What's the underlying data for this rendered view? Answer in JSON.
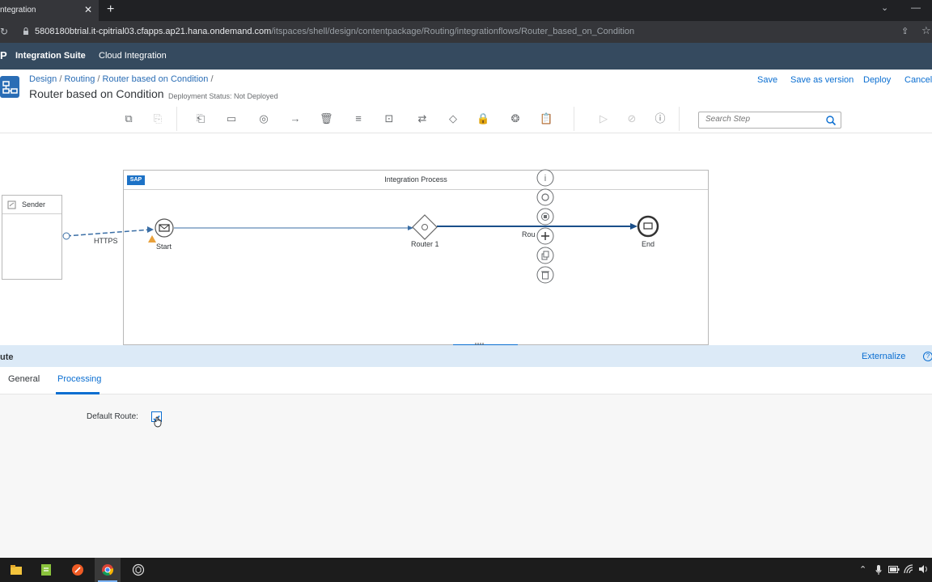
{
  "browser": {
    "tab_title": "ntegration",
    "tab_close": "✕",
    "new_tab": "+",
    "url_host": "5808180btrial.it-cpitrial03.cfapps.ap21.hana.ondemand.com",
    "url_path": "/itspaces/shell/design/contentpackage/Routing/integrationflows/Router_based_on_Condition"
  },
  "shell": {
    "logo_letter": "P",
    "suite_title": "Integration Suite",
    "product": "Cloud Integration"
  },
  "header": {
    "breadcrumbs": [
      "Design",
      "Routing",
      "Router based on Condition"
    ],
    "title": "Router based on Condition",
    "deployment_status": "Deployment Status: Not Deployed",
    "actions": {
      "save": "Save",
      "save_as_version": "Save as version",
      "deploy": "Deploy",
      "cancel": "Cancel"
    }
  },
  "toolbar": {
    "search_placeholder": "Search Step"
  },
  "canvas": {
    "pool_title": "Integration Process",
    "sap_logo": "SAP",
    "sender_label": "Sender",
    "https_label": "HTTPS",
    "start_label": "Start",
    "router_label": "Router 1",
    "route_partial": "Rou",
    "end_label": "End"
  },
  "properties": {
    "title": "ute",
    "externalize": "Externalize",
    "help": "?",
    "tabs": [
      "General",
      "Processing"
    ],
    "selected_tab": "Processing",
    "default_route_label": "Default Route:",
    "default_route_checked": true
  },
  "colors": {
    "shell_bg": "#354a5f",
    "accent": "#0a6ed1",
    "props_header_bg": "#dceaf7"
  }
}
